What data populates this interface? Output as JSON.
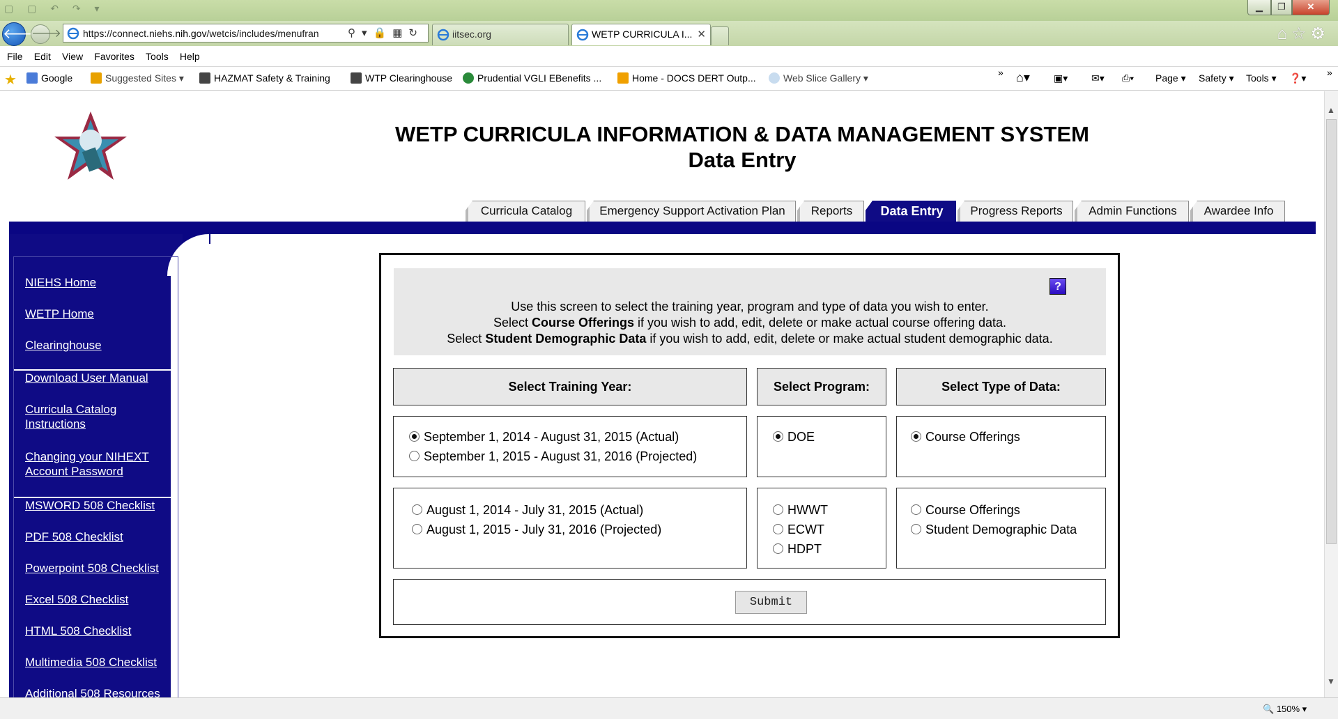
{
  "browser": {
    "address": {
      "url_prefix": "https://connect.niehs.",
      "url_domain": "nih.gov",
      "url_suffix": "/wetcis/includes/menufran"
    },
    "tabs": [
      {
        "label": "iitsec.org"
      },
      {
        "label": "WETP CURRICULA I..."
      }
    ],
    "menu": [
      "File",
      "Edit",
      "View",
      "Favorites",
      "Tools",
      "Help"
    ],
    "favorites": [
      {
        "label": "Google"
      },
      {
        "label": "Suggested Sites ▾"
      },
      {
        "label": "HAZMAT Safety & Training"
      },
      {
        "label": "WTP Clearinghouse"
      },
      {
        "label": "Prudential VGLI  EBenefits ..."
      },
      {
        "label": "Home - DOCS DERT Outp..."
      },
      {
        "label": "Web Slice Gallery ▾"
      }
    ],
    "commands": [
      "Page ▾",
      "Safety ▾",
      "Tools ▾"
    ],
    "zoom": "150%",
    "colors": {
      "nav_blue": "#0f0b85",
      "header_bar": "#0a0683",
      "chrome_green": "#c4d6a8"
    }
  },
  "page": {
    "title": "WETP CURRICULA INFORMATION & DATA MANAGEMENT SYSTEM",
    "subtitle": "Data Entry",
    "tabs": [
      {
        "label": "Curricula Catalog",
        "active": false
      },
      {
        "label": "Emergency Support Activation Plan",
        "active": false
      },
      {
        "label": "Reports",
        "active": false
      },
      {
        "label": "Data Entry",
        "active": true
      },
      {
        "label": "Progress Reports",
        "active": false
      },
      {
        "label": "Admin Functions",
        "active": false
      },
      {
        "label": "Awardee Info",
        "active": false
      }
    ],
    "sidebar": {
      "links": [
        "NIEHS Home",
        "WETP Home",
        "Clearinghouse",
        "Download User Manual",
        "Curricula Catalog Instructions",
        "Changing your NIHEXT Account Password",
        "MSWORD 508 Checklist",
        "PDF 508 Checklist",
        "Powerpoint 508 Checklist",
        "Excel 508 Checklist",
        "HTML 508 Checklist",
        "Multimedia 508 Checklist",
        "Additional 508 Resources"
      ]
    },
    "info": {
      "help": "?",
      "line1": "Use this screen to select the training year, program and type of data you wish to enter.",
      "line2_pre": "Select ",
      "line2_bold": "Course Offerings",
      "line2_post": " if you wish to add, edit, delete or make actual course offering data.",
      "line3_pre": "Select ",
      "line3_bold": "Student Demographic Data",
      "line3_post": " if you wish to add, edit, delete or make actual student demographic data."
    },
    "headers": {
      "year": "Select Training Year:",
      "program": "Select Program:",
      "type": "Select Type of Data:"
    },
    "row1": {
      "years": [
        {
          "label": "September 1, 2014 - August 31, 2015 (Actual)",
          "checked": true
        },
        {
          "label": "September 1, 2015 - August 31, 2016 (Projected)",
          "checked": false
        }
      ],
      "programs": [
        {
          "label": "DOE",
          "checked": true
        }
      ],
      "types": [
        {
          "label": "Course Offerings",
          "checked": true
        }
      ]
    },
    "row2": {
      "years": [
        {
          "label": "August 1, 2014 - July 31, 2015 (Actual)",
          "checked": false
        },
        {
          "label": "August 1, 2015 - July 31, 2016 (Projected)",
          "checked": false
        }
      ],
      "programs": [
        {
          "label": "HWWT",
          "checked": false
        },
        {
          "label": "ECWT",
          "checked": false
        },
        {
          "label": "HDPT",
          "checked": false
        }
      ],
      "types": [
        {
          "label": "Course Offerings",
          "checked": false
        },
        {
          "label": "Student Demographic Data",
          "checked": false
        }
      ]
    },
    "submit_label": "Submit"
  }
}
